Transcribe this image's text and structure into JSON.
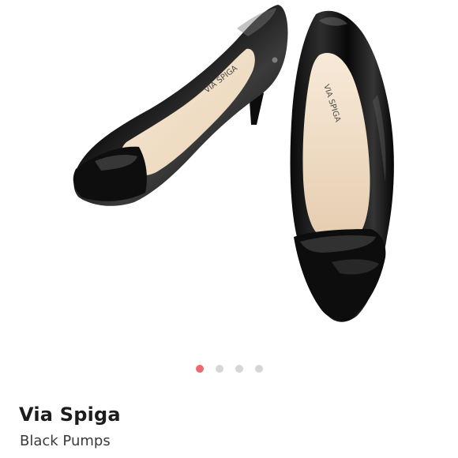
{
  "product": {
    "brand": "Via Spiga",
    "title": "Black Pumps",
    "insole_brand_text": "VIA SPIGA"
  },
  "carousel": {
    "total_images": 4,
    "active_index": 0,
    "active_color": "#f0686e",
    "inactive_color": "#d6d6d6"
  },
  "icons": {
    "image": "product-photo",
    "dots": "page-indicator-dot"
  }
}
